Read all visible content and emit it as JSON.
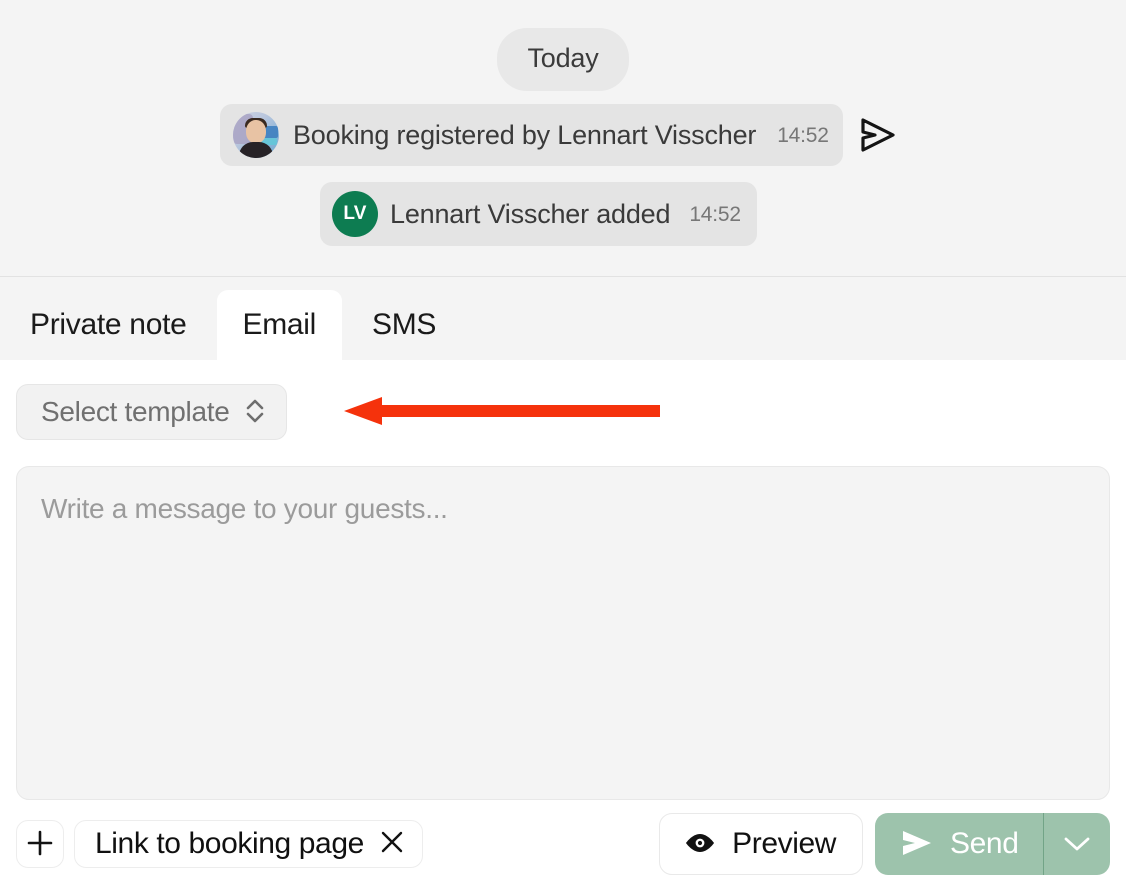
{
  "conversation": {
    "day_divider": "Today",
    "messages": [
      {
        "avatar_type": "photo",
        "avatar_name": "user-avatar-photo",
        "text": "Booking registered by Lennart Visscher",
        "time": "14:52",
        "status_icon": "send-outline-icon"
      },
      {
        "avatar_type": "initials",
        "avatar_initials": "LV",
        "text": "Lennart Visscher added",
        "time": "14:52"
      }
    ]
  },
  "tabs": [
    {
      "label": "Private note",
      "active": false
    },
    {
      "label": "Email",
      "active": true
    },
    {
      "label": "SMS",
      "active": false
    }
  ],
  "composer": {
    "template_select": {
      "label": "Select template",
      "icon": "chevron-up-down-icon"
    },
    "message": {
      "placeholder": "Write a message to your guests...",
      "value": ""
    }
  },
  "toolbar": {
    "add_label": "+",
    "attachment_chip": {
      "label": "Link to booking page",
      "remove_icon": "close-icon"
    },
    "preview_label": "Preview",
    "send_label": "Send",
    "send_caret_icon": "chevron-down-icon"
  },
  "annotation": {
    "type": "arrow",
    "direction": "left",
    "color": "#f5320c",
    "points_to": "Select template"
  },
  "colors": {
    "page_background": "#f4f4f4",
    "composer_background": "#ffffff",
    "bubble_background": "#e4e4e4",
    "avatar_green": "#0d7c51",
    "send_button_green": "#9dc3ac",
    "annotation_red": "#f5320c",
    "muted_text": "#777777"
  }
}
